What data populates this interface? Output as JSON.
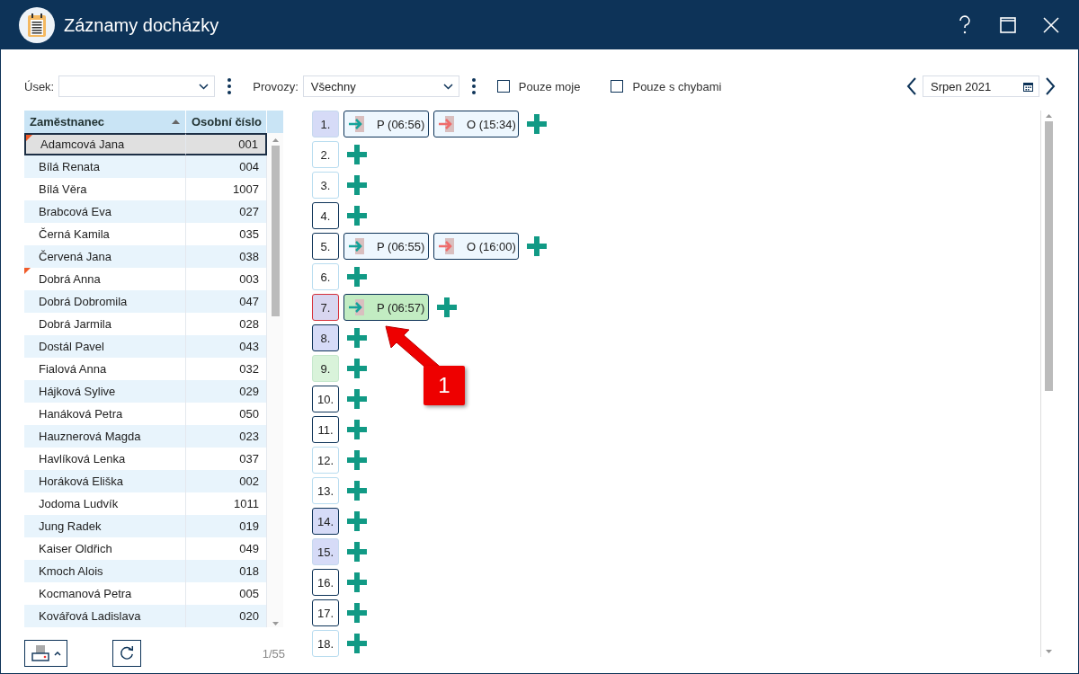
{
  "window": {
    "title": "Záznamy docházky"
  },
  "filters": {
    "usek": {
      "label": "Úsek:"
    },
    "provozy": {
      "label": "Provozy:",
      "value": "Všechny"
    },
    "checkboxes": [
      {
        "label": "Pouze moje",
        "checked": false
      },
      {
        "label": "Pouze s chybami",
        "checked": false
      }
    ],
    "month": "Srpen 2021"
  },
  "table": {
    "columns": [
      "Zaměstnanec",
      "Osobní číslo"
    ],
    "rows": [
      {
        "name": "Adamcová Jana",
        "number": "001",
        "selected": true,
        "flag": true
      },
      {
        "name": "Bílá Renata",
        "number": "004",
        "selected": false,
        "flag": false
      },
      {
        "name": "Bílá Věra",
        "number": "1007",
        "selected": false,
        "flag": false
      },
      {
        "name": "Brabcová Eva",
        "number": "027",
        "selected": false,
        "flag": false
      },
      {
        "name": "Černá Kamila",
        "number": "035",
        "selected": false,
        "flag": false
      },
      {
        "name": "Červená Jana",
        "number": "038",
        "selected": false,
        "flag": false
      },
      {
        "name": "Dobrá Anna",
        "number": "003",
        "selected": false,
        "flag": true
      },
      {
        "name": "Dobrá Dobromila",
        "number": "047",
        "selected": false,
        "flag": false
      },
      {
        "name": "Dobrá Jarmila",
        "number": "028",
        "selected": false,
        "flag": false
      },
      {
        "name": "Dostál Pavel",
        "number": "043",
        "selected": false,
        "flag": false
      },
      {
        "name": "Fialová Anna",
        "number": "032",
        "selected": false,
        "flag": false
      },
      {
        "name": "Hájková Sylive",
        "number": "029",
        "selected": false,
        "flag": false
      },
      {
        "name": "Hanáková Petra",
        "number": "050",
        "selected": false,
        "flag": false
      },
      {
        "name": "Hauznerová Magda",
        "number": "023",
        "selected": false,
        "flag": false
      },
      {
        "name": "Havlíková Lenka",
        "number": "037",
        "selected": false,
        "flag": false
      },
      {
        "name": "Horáková Eliška",
        "number": "002",
        "selected": false,
        "flag": false
      },
      {
        "name": "Jodoma Ludvík",
        "number": "1011",
        "selected": false,
        "flag": false
      },
      {
        "name": "Jung Radek",
        "number": "019",
        "selected": false,
        "flag": false
      },
      {
        "name": "Kaiser Oldřich",
        "number": "049",
        "selected": false,
        "flag": false
      },
      {
        "name": "Kmoch Alois",
        "number": "018",
        "selected": false,
        "flag": false
      },
      {
        "name": "Kocmanová Petra",
        "number": "005",
        "selected": false,
        "flag": false
      },
      {
        "name": "Kovářová Ladislava",
        "number": "020",
        "selected": false,
        "flag": false
      }
    ],
    "count": "1/55"
  },
  "days": [
    {
      "label": "1.",
      "kind": "weekend",
      "records": [
        {
          "kind": "arrival",
          "label": "P (06:56)",
          "selected": false
        },
        {
          "kind": "departure",
          "label": "O (15:34)",
          "selected": false
        }
      ]
    },
    {
      "label": "2.",
      "kind": "free"
    },
    {
      "label": "3.",
      "kind": "free"
    },
    {
      "label": "4.",
      "kind": "workday"
    },
    {
      "label": "5.",
      "kind": "workday",
      "records": [
        {
          "kind": "arrival",
          "label": "P (06:55)",
          "selected": false
        },
        {
          "kind": "departure",
          "label": "O (16:00)",
          "selected": false
        }
      ]
    },
    {
      "label": "6.",
      "kind": "free"
    },
    {
      "label": "7.",
      "kind": "error",
      "records": [
        {
          "kind": "arrival",
          "label": "P (06:57)",
          "selected": true
        }
      ]
    },
    {
      "label": "8.",
      "kind": "weekend-marked"
    },
    {
      "label": "9.",
      "kind": "holiday"
    },
    {
      "label": "10.",
      "kind": "workday"
    },
    {
      "label": "11.",
      "kind": "workday"
    },
    {
      "label": "12.",
      "kind": "free"
    },
    {
      "label": "13.",
      "kind": "free"
    },
    {
      "label": "14.",
      "kind": "weekend-marked"
    },
    {
      "label": "15.",
      "kind": "weekend"
    },
    {
      "label": "16.",
      "kind": "workday"
    },
    {
      "label": "17.",
      "kind": "workday"
    },
    {
      "label": "18.",
      "kind": "free"
    }
  ],
  "callout": {
    "label": "1"
  }
}
